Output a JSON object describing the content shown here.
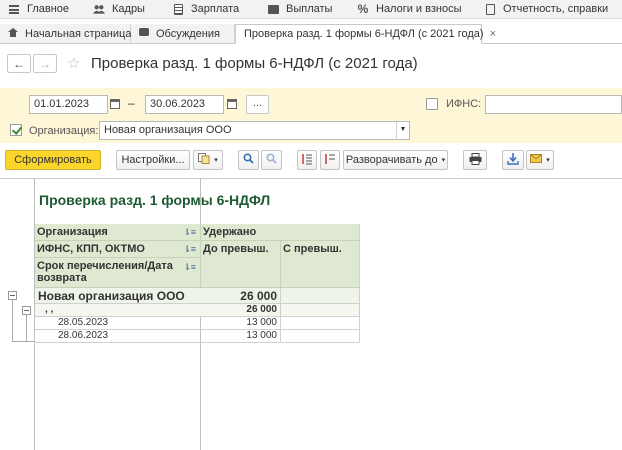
{
  "sections": [
    {
      "label": "Главное",
      "icon": "menu-icon"
    },
    {
      "label": "Кадры",
      "icon": "people-icon"
    },
    {
      "label": "Зарплата",
      "icon": "calculator-icon"
    },
    {
      "label": "Выплаты",
      "icon": "wallet-icon"
    },
    {
      "label": "Налоги и взносы",
      "icon": "percent-icon"
    },
    {
      "label": "Отчетность, справки",
      "icon": "report-icon"
    }
  ],
  "tabs": [
    {
      "label": "Начальная страница",
      "icon": "home-icon"
    },
    {
      "label": "Обсуждения",
      "icon": "chat-icon"
    },
    {
      "label": "Проверка разд. 1 формы 6-НДФЛ (с 2021 года)",
      "close": "×"
    }
  ],
  "title": "Проверка разд. 1 формы 6-НДФЛ (с 2021 года)",
  "nav": {
    "back": "←",
    "forward": "→",
    "favorite": "☆"
  },
  "filter": {
    "date_from": "01.01.2023",
    "dash": "–",
    "date_to": "30.06.2023",
    "period_button": "...",
    "ifns_label": "ИФНС:",
    "ifns_value": "",
    "org_label": "Организация:",
    "org_value": "Новая организация ООО",
    "org_checked": true,
    "ifns_checked": false
  },
  "toolbar": {
    "generate": "Сформировать",
    "settings": "Настройки...",
    "expand": "Разворачивать до",
    "caret": "▾"
  },
  "report": {
    "title": "Проверка разд. 1 формы 6-НДФЛ",
    "headers": {
      "org": "Организация",
      "ifns": "ИФНС, КПП, ОКТМО",
      "deadline": "Срок перечисления/Дата возврата",
      "withheld": "Удержано",
      "before_excess": "До превыш.",
      "after_excess": "С превыш."
    },
    "rows": [
      {
        "label": "Новая организация ООО",
        "before": "26 000",
        "after": ""
      },
      {
        "label": ", ,",
        "before": "26 000",
        "after": ""
      },
      {
        "label": "28.05.2023",
        "before": "13 000",
        "after": ""
      },
      {
        "label": "28.06.2023",
        "before": "13 000",
        "after": ""
      }
    ],
    "sort_mark": "⇂≡"
  },
  "colors": {
    "primary_button": "#fbd52a",
    "filter_bg": "#fdf6d7",
    "header_bg": "#dfe9d2",
    "title_color": "#1e5a33"
  }
}
